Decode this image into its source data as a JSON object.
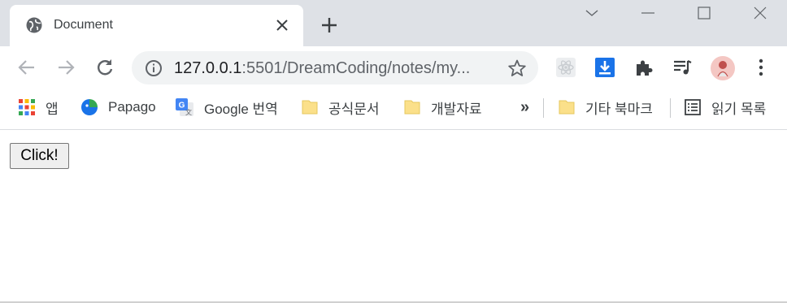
{
  "tab": {
    "title": "Document",
    "favicon": "globe-icon"
  },
  "address_bar": {
    "info_icon": "info-icon",
    "url_host": "127.0.0.1",
    "url_rest": ":5501/DreamCoding/notes/my..."
  },
  "bookmarks": {
    "items": [
      {
        "label": "앱",
        "icon": "apps-grid-icon"
      },
      {
        "label": "Papago",
        "icon": "papago-icon"
      },
      {
        "label": "Google 번역",
        "icon": "google-translate-icon"
      },
      {
        "label": "공식문서",
        "icon": "folder-icon"
      },
      {
        "label": "개발자료",
        "icon": "folder-icon"
      },
      {
        "label": "기타 북마크",
        "icon": "folder-icon"
      },
      {
        "label": "읽기 목록",
        "icon": "reading-list-icon"
      }
    ],
    "overflow_label": "»"
  },
  "page": {
    "button_label": "Click!"
  },
  "colors": {
    "tabstrip_bg": "#dee1e6",
    "omnibox_bg": "#f1f3f4",
    "folder": "#fbe08a",
    "download_blue": "#1a73e8"
  }
}
